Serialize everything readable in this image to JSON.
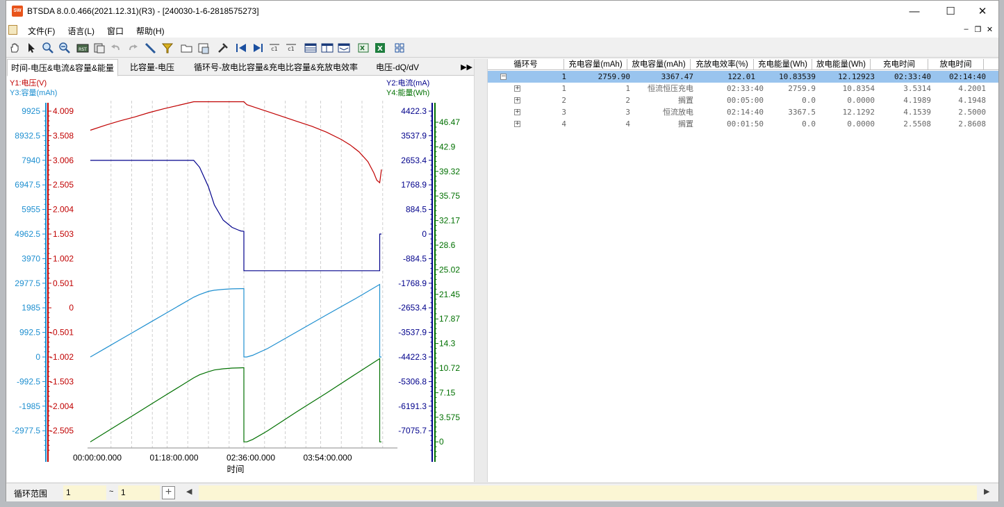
{
  "window": {
    "title": "BTSDA 8.0.0.466(2021.12.31)(R3) - [240030-1-6-2818575273]",
    "app_icon": "app-logo-icon",
    "minimize": "—",
    "maximize": "☐",
    "close": "✕"
  },
  "menu": {
    "items": [
      "文件(F)",
      "语言(L)",
      "窗口",
      "帮助(H)"
    ],
    "mdi": [
      "–",
      "❐",
      "✕"
    ]
  },
  "toolbar": {
    "icons": [
      "hand-icon",
      "pointer-icon",
      "zoom-in-icon",
      "zoom-out-icon",
      "reset-icon",
      "copy-icon",
      "undo-icon",
      "redo-icon",
      "measure-icon",
      "filter-icon",
      "open-icon",
      "save-icon",
      "settings-icon",
      "prev-icon",
      "next-icon",
      "cycle-prev-icon",
      "cycle-next-icon",
      "table-icon",
      "table-icon-2",
      "table-icon-3",
      "excel-icon",
      "excel-icon-2",
      "grid-icon"
    ]
  },
  "tabs": [
    "时间-电压&电流&容量&能量",
    "比容量-电压",
    "循环号-放电比容量&充电比容量&充放电效率",
    "电压-dQ/dV"
  ],
  "tab_scroll": "▶▶",
  "chart_data": {
    "type": "line",
    "title": "",
    "xlabel": "时间",
    "x_ticks": [
      "00:00:00.000",
      "01:18:00.000",
      "02:36:00.000",
      "03:54:00.000"
    ],
    "legend_left": [
      "Y1:电压(V)",
      "Y3:容量(mAh)"
    ],
    "legend_right": [
      "Y2:电流(mA)",
      "Y4:能量(Wh)"
    ],
    "axes": {
      "y1": {
        "label": "Y1:电压(V)",
        "color": "#c00000",
        "ticks": [
          "4.009",
          "3.508",
          "3.006",
          "2.505",
          "2.004",
          "1.503",
          "1.002",
          "0.501",
          "0",
          "-0.501",
          "-1.002",
          "-1.503",
          "-2.004",
          "-2.505"
        ]
      },
      "y3": {
        "label": "Y3:容量(mAh)",
        "color": "#1e8fd0",
        "ticks": [
          "9925",
          "8932.5",
          "7940",
          "6947.5",
          "5955",
          "4962.5",
          "3970",
          "2977.5",
          "1985",
          "992.5",
          "0",
          "-992.5",
          "-1985",
          "-2977.5"
        ]
      },
      "y2": {
        "label": "Y2:电流(mA)",
        "color": "#00008b",
        "ticks": [
          "4422.3",
          "3537.9",
          "2653.4",
          "1768.9",
          "884.5",
          "0",
          "-884.5",
          "-1768.9",
          "-2653.4",
          "-3537.9",
          "-4422.3",
          "-5306.8",
          "-6191.3",
          "-7075.7"
        ]
      },
      "y4": {
        "label": "Y4:能量(Wh)",
        "color": "#007000",
        "ticks": [
          "46.47",
          "42.9",
          "39.32",
          "35.75",
          "32.17",
          "28.6",
          "25.02",
          "21.45",
          "17.87",
          "14.3",
          "10.72",
          "7.15",
          "3.575",
          "0"
        ]
      }
    },
    "series": [
      {
        "name": "电压(V)",
        "axis": "y1",
        "color": "#c00000",
        "x": [
          0,
          0.25,
          0.5,
          0.75,
          1.0,
          1.25,
          1.5,
          1.75,
          2.0,
          2.1,
          2.25,
          2.5,
          2.6,
          2.65,
          2.75,
          3.0,
          3.25,
          3.5,
          3.75,
          4.0,
          4.25,
          4.4,
          4.55,
          4.7,
          4.8,
          4.85,
          4.9,
          4.93
        ],
        "y": [
          3.62,
          3.72,
          3.81,
          3.89,
          3.98,
          4.06,
          4.13,
          4.2,
          4.2,
          4.2,
          4.2,
          4.2,
          4.2,
          4.14,
          4.1,
          4.0,
          3.9,
          3.8,
          3.7,
          3.58,
          3.43,
          3.32,
          3.18,
          2.98,
          2.75,
          2.6,
          2.55,
          2.82
        ]
      },
      {
        "name": "电流(mA)",
        "axis": "y2",
        "color": "#00008b",
        "x": [
          0,
          0.5,
          1.0,
          1.5,
          1.75,
          1.85,
          2.0,
          2.1,
          2.25,
          2.4,
          2.5,
          2.55,
          2.6,
          2.6,
          2.75,
          3.25,
          3.75,
          4.25,
          4.75,
          4.9,
          4.9,
          4.93
        ],
        "y": [
          2650,
          2650,
          2650,
          2650,
          2650,
          2400,
          1700,
          1050,
          500,
          240,
          150,
          110,
          100,
          -1320,
          -1320,
          -1320,
          -1320,
          -1320,
          -1320,
          -1320,
          0,
          0
        ]
      },
      {
        "name": "容量(mAh)",
        "axis": "y3",
        "color": "#1e8fd0",
        "x": [
          0,
          0.25,
          0.5,
          0.75,
          1.0,
          1.25,
          1.5,
          1.75,
          1.85,
          2.0,
          2.1,
          2.25,
          2.4,
          2.55,
          2.6,
          2.6,
          2.65,
          2.75,
          3.0,
          3.5,
          4.0,
          4.5,
          4.9,
          4.9,
          4.93
        ],
        "y": [
          0,
          345,
          690,
          1035,
          1380,
          1725,
          2070,
          2415,
          2520,
          2650,
          2695,
          2730,
          2750,
          2758,
          2760,
          0,
          0,
          70,
          340,
          1020,
          1700,
          2370,
          2930,
          0,
          0
        ]
      },
      {
        "name": "能量(Wh)",
        "axis": "y4",
        "color": "#007000",
        "x": [
          0,
          0.25,
          0.5,
          0.75,
          1.0,
          1.25,
          1.5,
          1.75,
          1.85,
          2.0,
          2.1,
          2.25,
          2.4,
          2.55,
          2.6,
          2.6,
          2.65,
          2.75,
          3.0,
          3.5,
          4.0,
          4.5,
          4.9,
          4.9,
          4.93
        ],
        "y": [
          0,
          1.33,
          2.66,
          3.99,
          5.32,
          6.65,
          7.98,
          9.31,
          9.75,
          10.2,
          10.45,
          10.62,
          10.72,
          10.76,
          10.78,
          0,
          0,
          0.35,
          1.6,
          4.4,
          7.1,
          9.9,
          12.1,
          0,
          0
        ]
      }
    ]
  },
  "grid": {
    "headers": [
      "循环号",
      "充电容量(mAh)",
      "放电容量(mAh)",
      "充放电效率(%)",
      "充电能量(Wh)",
      "放电能量(Wh)",
      "充电时间",
      "放电时间"
    ],
    "summary": {
      "expander": "−",
      "cycle": "1",
      "charge_cap": "2759.90",
      "discharge_cap": "3367.47",
      "efficiency": "122.01",
      "charge_energy": "10.83539",
      "discharge_energy": "12.12923",
      "charge_time": "02:33:40",
      "discharge_time": "02:14:40"
    },
    "steps": [
      {
        "expander": "+",
        "a": "1",
        "b": "1",
        "mode": "恒流恒压充电",
        "time": "02:33:40",
        "cap": "2759.9",
        "energy": "10.8354",
        "v1": "3.5314",
        "v2": "4.2001"
      },
      {
        "expander": "+",
        "a": "2",
        "b": "2",
        "mode": "搁置",
        "time": "00:05:00",
        "cap": "0.0",
        "energy": "0.0000",
        "v1": "4.1989",
        "v2": "4.1948"
      },
      {
        "expander": "+",
        "a": "3",
        "b": "3",
        "mode": "恒流放电",
        "time": "02:14:40",
        "cap": "3367.5",
        "energy": "12.1292",
        "v1": "4.1539",
        "v2": "2.5000"
      },
      {
        "expander": "+",
        "a": "4",
        "b": "4",
        "mode": "搁置",
        "time": "00:01:50",
        "cap": "0.0",
        "energy": "0.0000",
        "v1": "2.5508",
        "v2": "2.8608"
      }
    ]
  },
  "status": {
    "label": "循环范围",
    "from": "1",
    "tilde": "~",
    "to": "1",
    "plus": "+",
    "left_arrow": "◀",
    "right_arrow": "▶"
  }
}
